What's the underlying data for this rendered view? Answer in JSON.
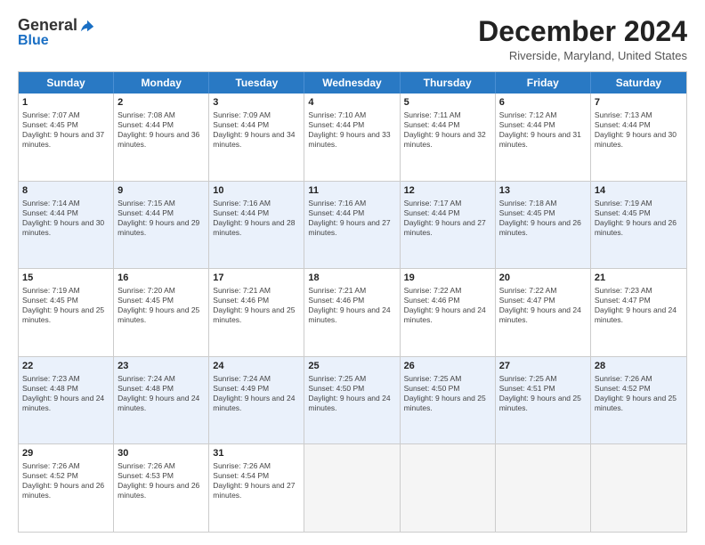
{
  "logo": {
    "general": "General",
    "blue": "Blue"
  },
  "title": "December 2024",
  "location": "Riverside, Maryland, United States",
  "weekdays": [
    "Sunday",
    "Monday",
    "Tuesday",
    "Wednesday",
    "Thursday",
    "Friday",
    "Saturday"
  ],
  "rows": [
    [
      {
        "day": "1",
        "sunrise": "Sunrise: 7:07 AM",
        "sunset": "Sunset: 4:45 PM",
        "daylight": "Daylight: 9 hours and 37 minutes."
      },
      {
        "day": "2",
        "sunrise": "Sunrise: 7:08 AM",
        "sunset": "Sunset: 4:44 PM",
        "daylight": "Daylight: 9 hours and 36 minutes."
      },
      {
        "day": "3",
        "sunrise": "Sunrise: 7:09 AM",
        "sunset": "Sunset: 4:44 PM",
        "daylight": "Daylight: 9 hours and 34 minutes."
      },
      {
        "day": "4",
        "sunrise": "Sunrise: 7:10 AM",
        "sunset": "Sunset: 4:44 PM",
        "daylight": "Daylight: 9 hours and 33 minutes."
      },
      {
        "day": "5",
        "sunrise": "Sunrise: 7:11 AM",
        "sunset": "Sunset: 4:44 PM",
        "daylight": "Daylight: 9 hours and 32 minutes."
      },
      {
        "day": "6",
        "sunrise": "Sunrise: 7:12 AM",
        "sunset": "Sunset: 4:44 PM",
        "daylight": "Daylight: 9 hours and 31 minutes."
      },
      {
        "day": "7",
        "sunrise": "Sunrise: 7:13 AM",
        "sunset": "Sunset: 4:44 PM",
        "daylight": "Daylight: 9 hours and 30 minutes."
      }
    ],
    [
      {
        "day": "8",
        "sunrise": "Sunrise: 7:14 AM",
        "sunset": "Sunset: 4:44 PM",
        "daylight": "Daylight: 9 hours and 30 minutes."
      },
      {
        "day": "9",
        "sunrise": "Sunrise: 7:15 AM",
        "sunset": "Sunset: 4:44 PM",
        "daylight": "Daylight: 9 hours and 29 minutes."
      },
      {
        "day": "10",
        "sunrise": "Sunrise: 7:16 AM",
        "sunset": "Sunset: 4:44 PM",
        "daylight": "Daylight: 9 hours and 28 minutes."
      },
      {
        "day": "11",
        "sunrise": "Sunrise: 7:16 AM",
        "sunset": "Sunset: 4:44 PM",
        "daylight": "Daylight: 9 hours and 27 minutes."
      },
      {
        "day": "12",
        "sunrise": "Sunrise: 7:17 AM",
        "sunset": "Sunset: 4:44 PM",
        "daylight": "Daylight: 9 hours and 27 minutes."
      },
      {
        "day": "13",
        "sunrise": "Sunrise: 7:18 AM",
        "sunset": "Sunset: 4:45 PM",
        "daylight": "Daylight: 9 hours and 26 minutes."
      },
      {
        "day": "14",
        "sunrise": "Sunrise: 7:19 AM",
        "sunset": "Sunset: 4:45 PM",
        "daylight": "Daylight: 9 hours and 26 minutes."
      }
    ],
    [
      {
        "day": "15",
        "sunrise": "Sunrise: 7:19 AM",
        "sunset": "Sunset: 4:45 PM",
        "daylight": "Daylight: 9 hours and 25 minutes."
      },
      {
        "day": "16",
        "sunrise": "Sunrise: 7:20 AM",
        "sunset": "Sunset: 4:45 PM",
        "daylight": "Daylight: 9 hours and 25 minutes."
      },
      {
        "day": "17",
        "sunrise": "Sunrise: 7:21 AM",
        "sunset": "Sunset: 4:46 PM",
        "daylight": "Daylight: 9 hours and 25 minutes."
      },
      {
        "day": "18",
        "sunrise": "Sunrise: 7:21 AM",
        "sunset": "Sunset: 4:46 PM",
        "daylight": "Daylight: 9 hours and 24 minutes."
      },
      {
        "day": "19",
        "sunrise": "Sunrise: 7:22 AM",
        "sunset": "Sunset: 4:46 PM",
        "daylight": "Daylight: 9 hours and 24 minutes."
      },
      {
        "day": "20",
        "sunrise": "Sunrise: 7:22 AM",
        "sunset": "Sunset: 4:47 PM",
        "daylight": "Daylight: 9 hours and 24 minutes."
      },
      {
        "day": "21",
        "sunrise": "Sunrise: 7:23 AM",
        "sunset": "Sunset: 4:47 PM",
        "daylight": "Daylight: 9 hours and 24 minutes."
      }
    ],
    [
      {
        "day": "22",
        "sunrise": "Sunrise: 7:23 AM",
        "sunset": "Sunset: 4:48 PM",
        "daylight": "Daylight: 9 hours and 24 minutes."
      },
      {
        "day": "23",
        "sunrise": "Sunrise: 7:24 AM",
        "sunset": "Sunset: 4:48 PM",
        "daylight": "Daylight: 9 hours and 24 minutes."
      },
      {
        "day": "24",
        "sunrise": "Sunrise: 7:24 AM",
        "sunset": "Sunset: 4:49 PM",
        "daylight": "Daylight: 9 hours and 24 minutes."
      },
      {
        "day": "25",
        "sunrise": "Sunrise: 7:25 AM",
        "sunset": "Sunset: 4:50 PM",
        "daylight": "Daylight: 9 hours and 24 minutes."
      },
      {
        "day": "26",
        "sunrise": "Sunrise: 7:25 AM",
        "sunset": "Sunset: 4:50 PM",
        "daylight": "Daylight: 9 hours and 25 minutes."
      },
      {
        "day": "27",
        "sunrise": "Sunrise: 7:25 AM",
        "sunset": "Sunset: 4:51 PM",
        "daylight": "Daylight: 9 hours and 25 minutes."
      },
      {
        "day": "28",
        "sunrise": "Sunrise: 7:26 AM",
        "sunset": "Sunset: 4:52 PM",
        "daylight": "Daylight: 9 hours and 25 minutes."
      }
    ],
    [
      {
        "day": "29",
        "sunrise": "Sunrise: 7:26 AM",
        "sunset": "Sunset: 4:52 PM",
        "daylight": "Daylight: 9 hours and 26 minutes."
      },
      {
        "day": "30",
        "sunrise": "Sunrise: 7:26 AM",
        "sunset": "Sunset: 4:53 PM",
        "daylight": "Daylight: 9 hours and 26 minutes."
      },
      {
        "day": "31",
        "sunrise": "Sunrise: 7:26 AM",
        "sunset": "Sunset: 4:54 PM",
        "daylight": "Daylight: 9 hours and 27 minutes."
      },
      null,
      null,
      null,
      null
    ]
  ]
}
